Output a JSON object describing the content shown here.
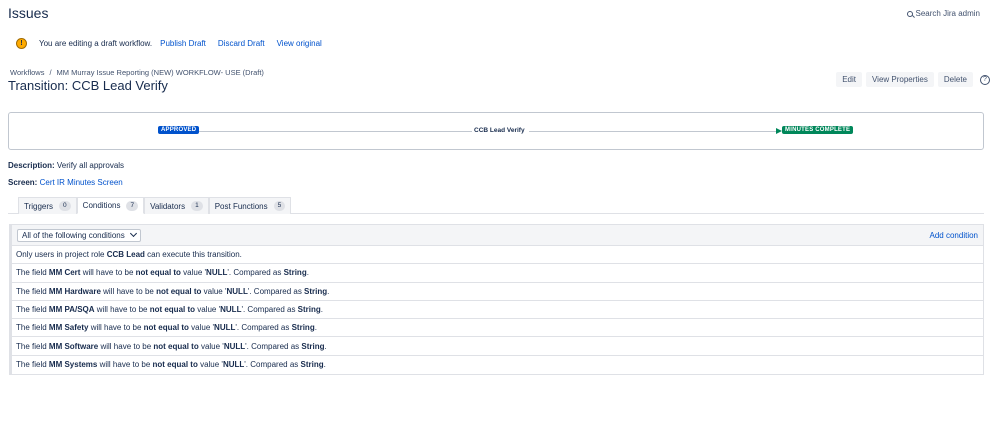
{
  "header": {
    "title": "Issues",
    "search_admin": "Search Jira admin",
    "search_icon": "search-icon"
  },
  "draft_bar": {
    "icon": "warning-icon",
    "message": "You are editing a draft workflow.",
    "publish": "Publish Draft",
    "discard": "Discard Draft",
    "view_original": "View original"
  },
  "breadcrumb": {
    "root": "Workflows",
    "separator": "/",
    "workflow": "MM Murray Issue Reporting (NEW) WORKFLOW- USE (Draft)"
  },
  "transition_title": "Transition: CCB Lead Verify",
  "actions": {
    "edit": "Edit",
    "view_properties": "View Properties",
    "delete": "Delete",
    "help": "?"
  },
  "diagram": {
    "from_status": "APPROVED",
    "transition_name": "CCB Lead Verify",
    "to_status": "MINUTES COMPLETE",
    "colors": {
      "from": "#0052cc",
      "to": "#00875a"
    }
  },
  "description": {
    "label": "Description:",
    "value": "Verify all approvals"
  },
  "screen": {
    "label": "Screen:",
    "value": "Cert IR Minutes Screen"
  },
  "tabs": [
    {
      "label": "Triggers",
      "count": "0"
    },
    {
      "label": "Conditions",
      "count": "7"
    },
    {
      "label": "Validators",
      "count": "1"
    },
    {
      "label": "Post Functions",
      "count": "5"
    }
  ],
  "conditions": {
    "selector": "All of the following conditions",
    "add": "Add condition",
    "role_row": {
      "prefix": "Only users in project role ",
      "role": "CCB Lead",
      "suffix": " can execute this transition."
    },
    "rows": [
      {
        "pre": "The field ",
        "field": "MM Cert",
        "mid": " will have to be ",
        "op": "not equal to",
        "vpre": " value '",
        "value": "NULL",
        "vpost": "'. Compared as ",
        "type": "String",
        "end": "."
      },
      {
        "pre": "The field ",
        "field": "MM Hardware",
        "mid": " will have to be ",
        "op": "not equal to",
        "vpre": " value '",
        "value": "NULL",
        "vpost": "'. Compared as ",
        "type": "String",
        "end": "."
      },
      {
        "pre": "The field ",
        "field": "MM PA/SQA",
        "mid": " will have to be ",
        "op": "not equal to",
        "vpre": " value '",
        "value": "NULL",
        "vpost": "'. Compared as ",
        "type": "String",
        "end": "."
      },
      {
        "pre": "The field ",
        "field": "MM Safety",
        "mid": " will have to be ",
        "op": "not equal to",
        "vpre": " value '",
        "value": "NULL",
        "vpost": "'. Compared as ",
        "type": "String",
        "end": "."
      },
      {
        "pre": "The field ",
        "field": "MM Software",
        "mid": " will have to be ",
        "op": "not equal to",
        "vpre": " value '",
        "value": "NULL",
        "vpost": "'. Compared as ",
        "type": "String",
        "end": "."
      },
      {
        "pre": "The field ",
        "field": "MM Systems",
        "mid": " will have to be ",
        "op": "not equal to",
        "vpre": " value '",
        "value": "NULL",
        "vpost": "'. Compared as ",
        "type": "String",
        "end": "."
      }
    ]
  }
}
